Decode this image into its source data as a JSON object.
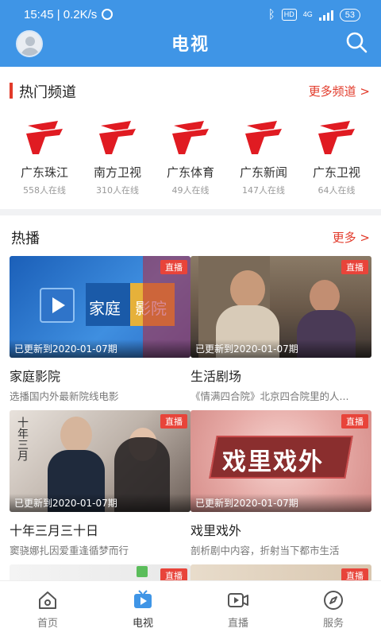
{
  "status_bar": {
    "time": "15:45 | 0.2K/s",
    "hd": "HD",
    "network": "4G",
    "battery": "53"
  },
  "header": {
    "title": "电视"
  },
  "hot_channels": {
    "section_title": "热门频道",
    "more_label": "更多频道 >",
    "items": [
      {
        "name": "广东珠江",
        "online": "558人在线"
      },
      {
        "name": "南方卫视",
        "online": "310人在线"
      },
      {
        "name": "广东体育",
        "online": "49人在线"
      },
      {
        "name": "广东新闻",
        "online": "147人在线"
      },
      {
        "name": "广东卫视",
        "online": "64人在线"
      }
    ]
  },
  "hot_play": {
    "section_title": "热播",
    "more_label": "更多 >",
    "cards": [
      {
        "badge": "直播",
        "updated": "已更新到2020-01-07期",
        "title": "家庭影院",
        "desc": "选播国内外最新院线电影",
        "thumb_text_1": "家庭",
        "thumb_text_2": "影院"
      },
      {
        "badge": "直播",
        "updated": "已更新到2020-01-07期",
        "title": "生活剧场",
        "desc": "《情满四合院》北京四合院里的人..."
      },
      {
        "badge": "直播",
        "updated": "已更新到2020-01-07期",
        "title": "十年三月三十日",
        "desc": "窦骁娜扎因爱重逢循梦而行",
        "thumb_text": "十年三月"
      },
      {
        "badge": "直播",
        "updated": "已更新到2020-01-07期",
        "title": "戏里戏外",
        "desc": "剖析剧中内容，折射当下都市生活",
        "thumb_text": "戏里戏外"
      },
      {
        "badge": "直播"
      },
      {
        "badge": "直播"
      }
    ]
  },
  "bottom_nav": [
    {
      "label": "首页",
      "icon": "home-icon"
    },
    {
      "label": "电视",
      "icon": "tv-icon",
      "active": true
    },
    {
      "label": "直播",
      "icon": "live-camera-icon"
    },
    {
      "label": "服务",
      "icon": "compass-icon"
    }
  ],
  "colors": {
    "header": "#3f95e6",
    "accent": "#e23a2a",
    "active_nav": "#3f95e6"
  }
}
